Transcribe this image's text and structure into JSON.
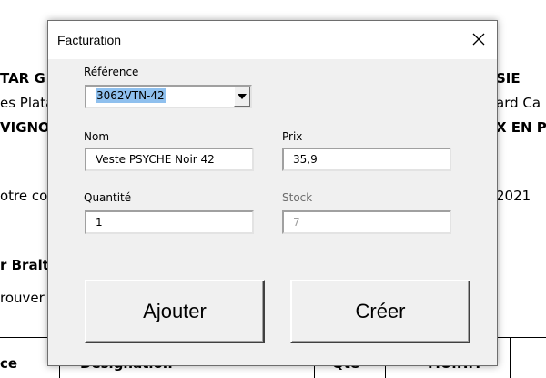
{
  "background": {
    "lines": [
      {
        "left": "TAR G",
        "right": "SIE"
      },
      {
        "left": "es Plata",
        "right": "ard Ca"
      },
      {
        "left": "VIGNO",
        "right": "X EN PR"
      },
      {
        "left": "otre co",
        "right": "2021"
      },
      {
        "left": "r Braltar",
        "right": ""
      },
      {
        "left": "rouver c",
        "right": ""
      }
    ],
    "table_headers": [
      "ce",
      "Désignation",
      "Qté",
      "P.U.H.T"
    ]
  },
  "dialog": {
    "title": "Facturation",
    "reference": {
      "label": "Référence",
      "value": "3062VTN-42"
    },
    "nom": {
      "label": "Nom",
      "value": "Veste PSYCHE Noir 42"
    },
    "prix": {
      "label": "Prix",
      "value": "35,9"
    },
    "quantite": {
      "label": "Quantité",
      "value": "1"
    },
    "stock": {
      "label": "Stock",
      "value": "7"
    },
    "buttons": {
      "ajouter": "Ajouter",
      "creer": "Créer"
    }
  }
}
